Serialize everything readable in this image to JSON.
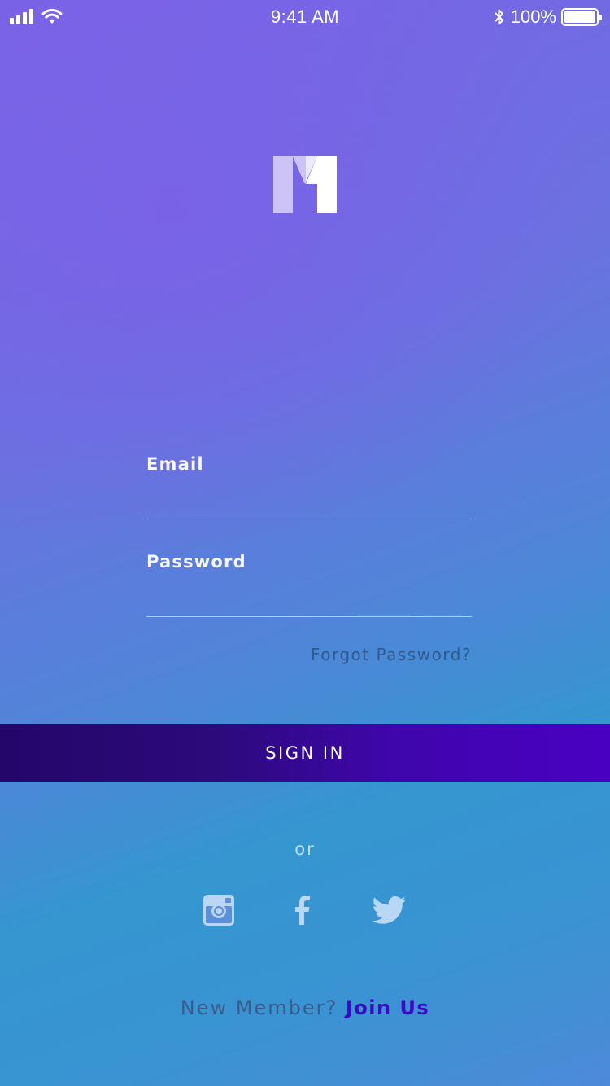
{
  "status_bar": {
    "time": "9:41 AM",
    "battery_percent": "100%",
    "icons": [
      "cellular-signal-icon",
      "wifi-icon",
      "bluetooth-icon",
      "battery-icon"
    ]
  },
  "logo": {
    "name": "m-logo"
  },
  "form": {
    "email": {
      "label": "Email",
      "value": "",
      "placeholder": ""
    },
    "password": {
      "label": "Password",
      "value": "",
      "placeholder": ""
    },
    "forgot_label": "Forgot Password?"
  },
  "signin_label": "SIGN IN",
  "divider_text": "or",
  "social": [
    "instagram-icon",
    "facebook-icon",
    "twitter-icon"
  ],
  "footer": {
    "prompt": "New Member?",
    "link": "Join Us"
  },
  "colors": {
    "gradient_top": "#7a63e6",
    "gradient_bottom": "#3a93d2",
    "button_start": "#23066a",
    "button_end": "#4a00c2",
    "link": "#3d08c7",
    "muted_text": "#3a5b8c"
  }
}
